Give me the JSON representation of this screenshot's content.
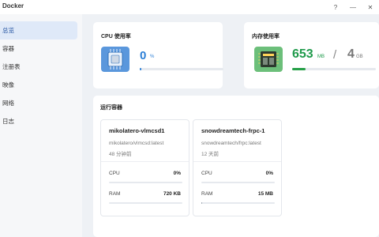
{
  "window": {
    "title": "Docker",
    "help_glyph": "?",
    "minimize_glyph": "—",
    "close_glyph": "✕"
  },
  "sidebar": {
    "items": [
      {
        "label": "总览",
        "active": true
      },
      {
        "label": "容器"
      },
      {
        "label": "注册表"
      },
      {
        "label": "映像"
      },
      {
        "label": "网络"
      },
      {
        "label": "日志"
      }
    ]
  },
  "cpu": {
    "title": "CPU 使用率",
    "value": "0",
    "unit": "%",
    "fraction": 0.02,
    "icon": "cpu-chip-icon",
    "color": "#2b7fd6"
  },
  "memory": {
    "title": "内存使用率",
    "used": "653",
    "used_unit": "MB",
    "separator": "/",
    "total": "4",
    "total_unit": "GB",
    "fraction": 0.16,
    "icon": "memory-module-icon",
    "color": "#1f9a4b"
  },
  "running": {
    "title": "运行容器",
    "cpu_label": "CPU",
    "ram_label": "RAM",
    "containers": [
      {
        "name": "mikolatero-vlmcsd1",
        "image": "mikolatero/vlmcsd:latest",
        "age": "48 分钟前",
        "cpu": "0%",
        "ram": "720 KB",
        "cpu_fraction": 0.0,
        "ram_fraction": 0.0
      },
      {
        "name": "snowdreamtech-frpc-1",
        "image": "snowdreamtech/frpc:latest",
        "age": "12 天前",
        "cpu": "0%",
        "ram": "15 MB",
        "cpu_fraction": 0.0,
        "ram_fraction": 0.01
      }
    ]
  }
}
